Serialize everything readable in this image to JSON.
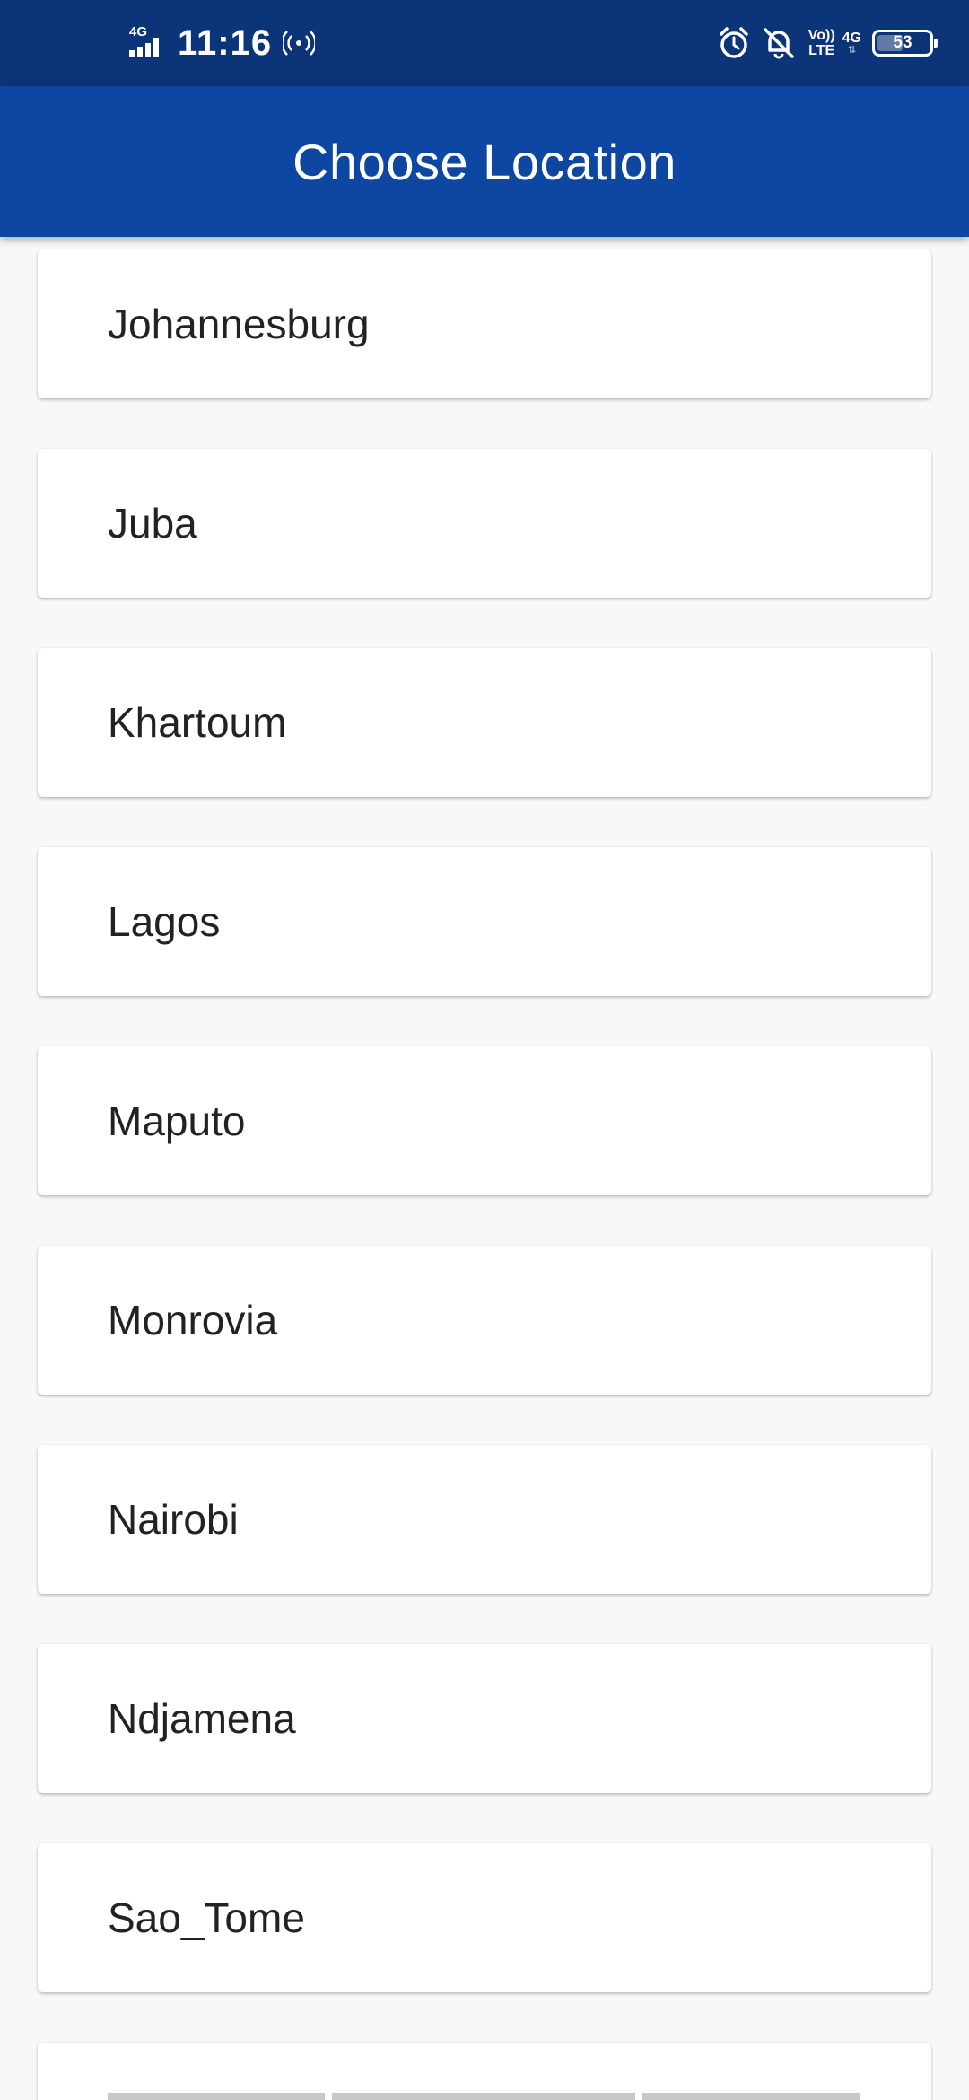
{
  "status_bar": {
    "network_type": "4G",
    "time": "11:16",
    "volte_top": "Vo))",
    "volte_bottom": "LTE",
    "data_type": "4G",
    "battery_level": "53",
    "icons": [
      "signal-icon",
      "hotspot-icon",
      "alarm-icon",
      "notifications-muted-icon",
      "volte-icon",
      "battery-icon"
    ]
  },
  "app_bar": {
    "title": "Choose Location"
  },
  "locations": [
    "Johannesburg",
    "Juba",
    "Khartoum",
    "Lagos",
    "Maputo",
    "Monrovia",
    "Nairobi",
    "Ndjamena",
    "Sao_Tome"
  ],
  "colors": {
    "status_bar": "#0b3578",
    "app_bar": "#0d47a1",
    "background": "#f8f8f8",
    "card": "#ffffff",
    "text": "#222222"
  }
}
